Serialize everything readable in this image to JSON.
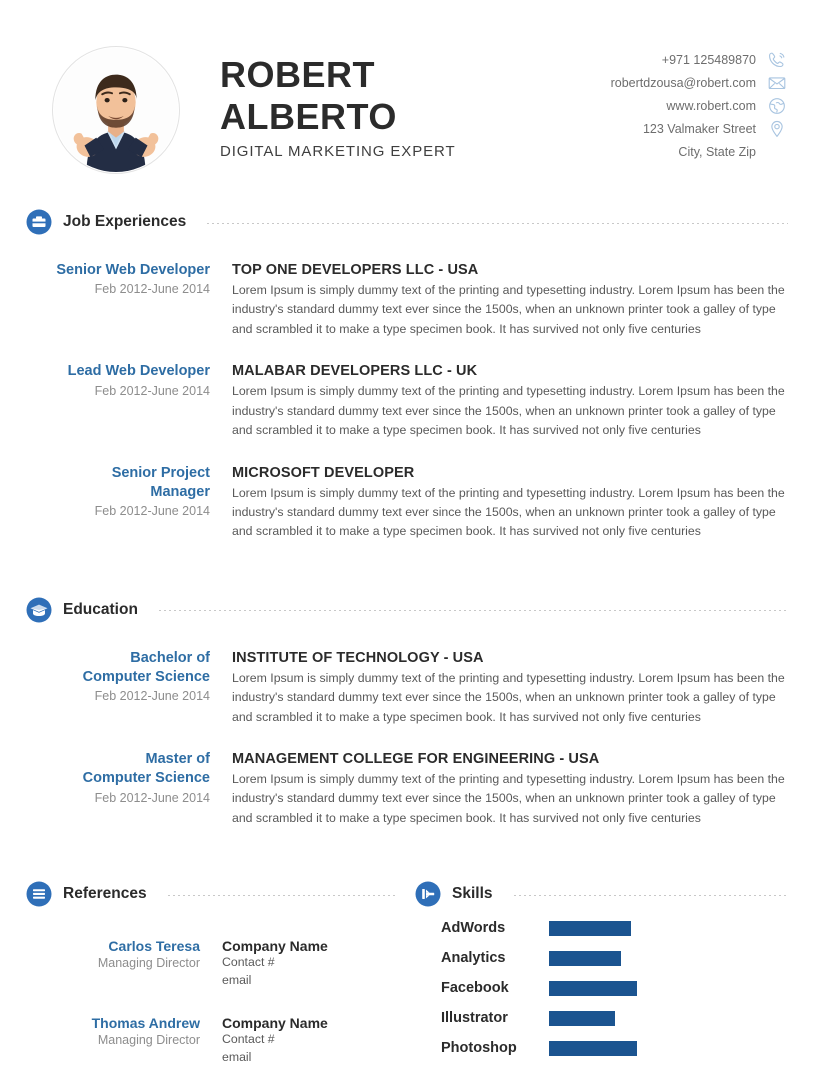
{
  "header": {
    "first_name": "ROBERT",
    "last_name": "ALBERTO",
    "job_title": "DIGITAL MARKETING  EXPERT",
    "photo_alt": "portrait-photo",
    "contact": [
      {
        "icon": "phone-icon",
        "text": "+971 125489870"
      },
      {
        "icon": "envelope-icon",
        "text": "robertdzousa@robert.com"
      },
      {
        "icon": "globe-icon",
        "text": "www.robert.com"
      },
      {
        "icon": "location-pin-icon",
        "text": "123 Valmaker Street"
      },
      {
        "icon": "",
        "text": "City, State Zip"
      }
    ]
  },
  "sections": {
    "job_experiences": {
      "title": "Job Experiences",
      "icon": "briefcase-icon",
      "entries": [
        {
          "title": "Senior Web Developer",
          "date": "Feb 2012-June 2014",
          "org": "TOP ONE DEVELOPERS LLC - USA",
          "desc": "Lorem Ipsum is simply dummy text of the printing and typesetting industry. Lorem Ipsum has been the industry's standard dummy text ever since the 1500s, when an unknown printer took a galley of type and scrambled it to make a type specimen book. It has survived not only five centuries"
        },
        {
          "title": "Lead Web Developer",
          "date": "Feb 2012-June 2014",
          "org": "MALABAR DEVELOPERS LLC - UK",
          "desc": "Lorem Ipsum is simply dummy text of the printing and typesetting industry. Lorem Ipsum has been the industry's standard dummy text ever since the 1500s, when an unknown printer took a galley of type and scrambled it to make a type specimen book. It has survived not only five centuries"
        },
        {
          "title": "Senior Project Manager",
          "date": "Feb 2012-June 2014",
          "org": "MICROSOFT DEVELOPER",
          "desc": "Lorem Ipsum is simply dummy text of the printing and typesetting industry. Lorem Ipsum has been the industry's standard dummy text ever since the 1500s, when an unknown printer took a galley of type and scrambled it to make a type specimen book. It has survived not only five centuries"
        }
      ]
    },
    "education": {
      "title": "Education",
      "icon": "graduation-cap-icon",
      "entries": [
        {
          "title": "Bachelor of\nComputer Science",
          "date": "Feb 2012-June 2014",
          "org": "INSTITUTE OF TECHNOLOGY - USA",
          "desc": "Lorem Ipsum is simply dummy text of the printing and typesetting industry. Lorem Ipsum has been the industry's standard dummy text ever since the 1500s, when an unknown printer took a galley of type and scrambled it to make a type specimen book. It has survived not only five centuries"
        },
        {
          "title": "Master of\nComputer Science",
          "date": "Feb 2012-June 2014",
          "org": "MANAGEMENT COLLEGE FOR ENGINEERING - USA",
          "desc": "Lorem Ipsum is simply dummy text of the printing and typesetting industry. Lorem Ipsum has been the industry's standard dummy text ever since the 1500s, when an unknown printer took a galley of type and scrambled it to make a type specimen book. It has survived not only five centuries"
        }
      ]
    },
    "references": {
      "title": "References",
      "icon": "list-lines-icon",
      "entries": [
        {
          "name": "Carlos Teresa",
          "role": "Managing Director",
          "company": "Company Name",
          "contact": "Contact #",
          "email": "email"
        },
        {
          "name": "Thomas Andrew",
          "role": "Managing Director",
          "company": "Company Name",
          "contact": "Contact #",
          "email": "email"
        }
      ]
    },
    "skills": {
      "title": "Skills",
      "icon": "skill-meter-icon"
    }
  },
  "chart_data": {
    "type": "bar",
    "title": "Skills",
    "orientation": "horizontal",
    "categories": [
      "AdWords",
      "Analytics",
      "Facebook",
      "Illustrator",
      "Photoshop"
    ],
    "values": [
      93,
      82,
      100,
      75,
      100
    ],
    "xlabel": "",
    "ylabel": "",
    "xlim": [
      0,
      100
    ],
    "grid": false,
    "bar_color": "#1b5490"
  },
  "colors": {
    "accent_blue": "#2e6da4",
    "icon_blue": "#2f6fb8",
    "bar_blue": "#1b5490",
    "contact_icon_blue": "#a8c4e0",
    "heading_dark": "#2b2b2b",
    "body_gray": "#595959",
    "muted_gray": "#8d8d8d"
  }
}
